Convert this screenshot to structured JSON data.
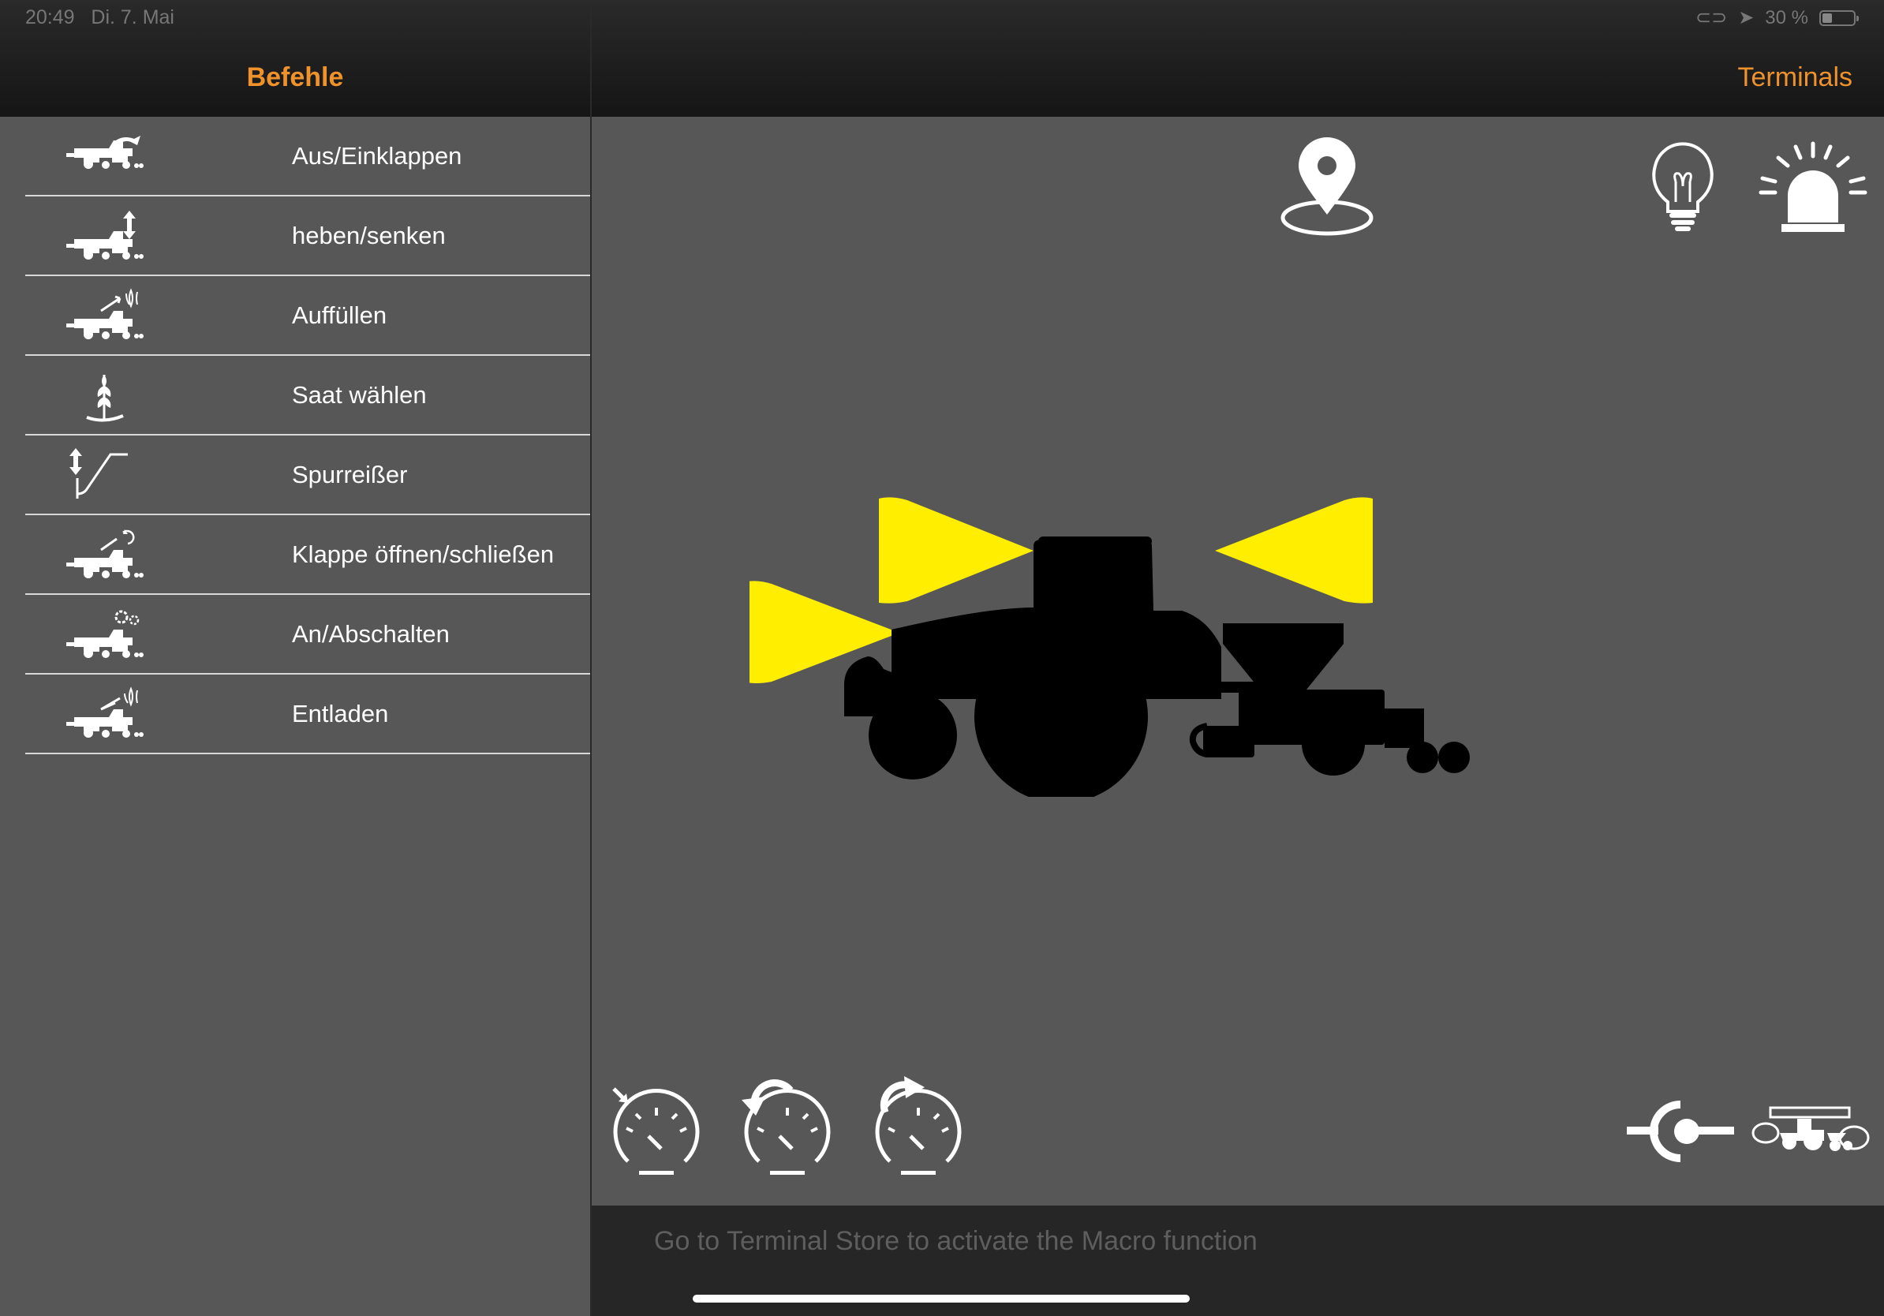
{
  "status_bar": {
    "time": "20:49",
    "date": "Di. 7. Mai",
    "battery": "30 %"
  },
  "sidebar": {
    "title": "Befehle",
    "items": [
      {
        "label": "Aus/Einklappen",
        "icon": "fold-icon"
      },
      {
        "label": "heben/senken",
        "icon": "raise-lower-icon"
      },
      {
        "label": "Auffüllen",
        "icon": "fill-icon"
      },
      {
        "label": "Saat wählen",
        "icon": "seed-icon"
      },
      {
        "label": "Spurreißer",
        "icon": "track-marker-icon"
      },
      {
        "label": "Klappe öffnen/schließen",
        "icon": "flap-icon"
      },
      {
        "label": "An/Abschalten",
        "icon": "on-off-icon"
      },
      {
        "label": "Entladen",
        "icon": "unload-icon"
      }
    ]
  },
  "header": {
    "terminals_label": "Terminals"
  },
  "main": {
    "top_icons": [
      "location-pin-icon",
      "light-bulb-icon",
      "beacon-icon"
    ],
    "work_lights_color": "#ffee00",
    "bottom_left_icons": [
      "speedometer-set-icon",
      "speedometer-reset-left-icon",
      "speedometer-reset-right-icon"
    ],
    "bottom_right_icons": [
      "hitch-icon",
      "tractor-seeder-icon"
    ]
  },
  "bottom_bar": {
    "macro_text": "Go to Terminal Store to activate the Macro function"
  },
  "colors": {
    "accent": "#f0922b",
    "background": "#575757",
    "header": "#1e1e1e",
    "light": "#ffee00"
  }
}
